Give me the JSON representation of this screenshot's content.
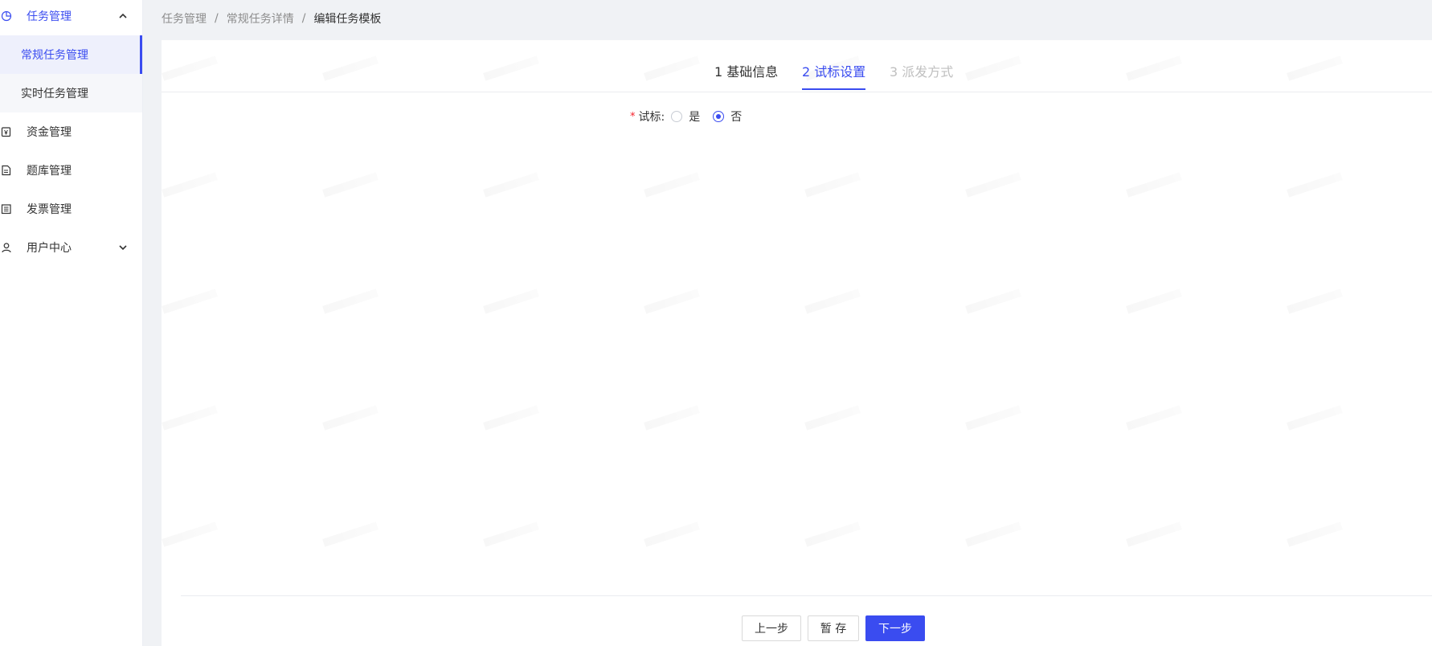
{
  "sidebar": {
    "items": [
      {
        "label": "任务管理",
        "icon": "pie-chart-icon",
        "expanded": true
      },
      {
        "label": "资金管理",
        "icon": "wallet-icon"
      },
      {
        "label": "题库管理",
        "icon": "document-icon"
      },
      {
        "label": "发票管理",
        "icon": "invoice-icon"
      },
      {
        "label": "用户中心",
        "icon": "user-icon",
        "expanded": false
      }
    ],
    "submenu": [
      {
        "label": "常规任务管理",
        "active": true
      },
      {
        "label": "实时任务管理"
      }
    ]
  },
  "breadcrumb": {
    "items": [
      "任务管理",
      "常规任务详情",
      "编辑任务模板"
    ],
    "separator": "/"
  },
  "steps": [
    {
      "label": "1 基础信息",
      "state": "done"
    },
    {
      "label": "2 试标设置",
      "state": "active"
    },
    {
      "label": "3 派发方式",
      "state": "pending"
    }
  ],
  "form": {
    "required_mark": "*",
    "field_label": "试标:",
    "options": [
      {
        "label": "是",
        "checked": false
      },
      {
        "label": "否",
        "checked": true
      }
    ]
  },
  "buttons": {
    "prev": "上一步",
    "save": "暂 存",
    "next": "下一步"
  },
  "colors": {
    "accent": "#3a4cf0",
    "required": "#f5222d"
  }
}
